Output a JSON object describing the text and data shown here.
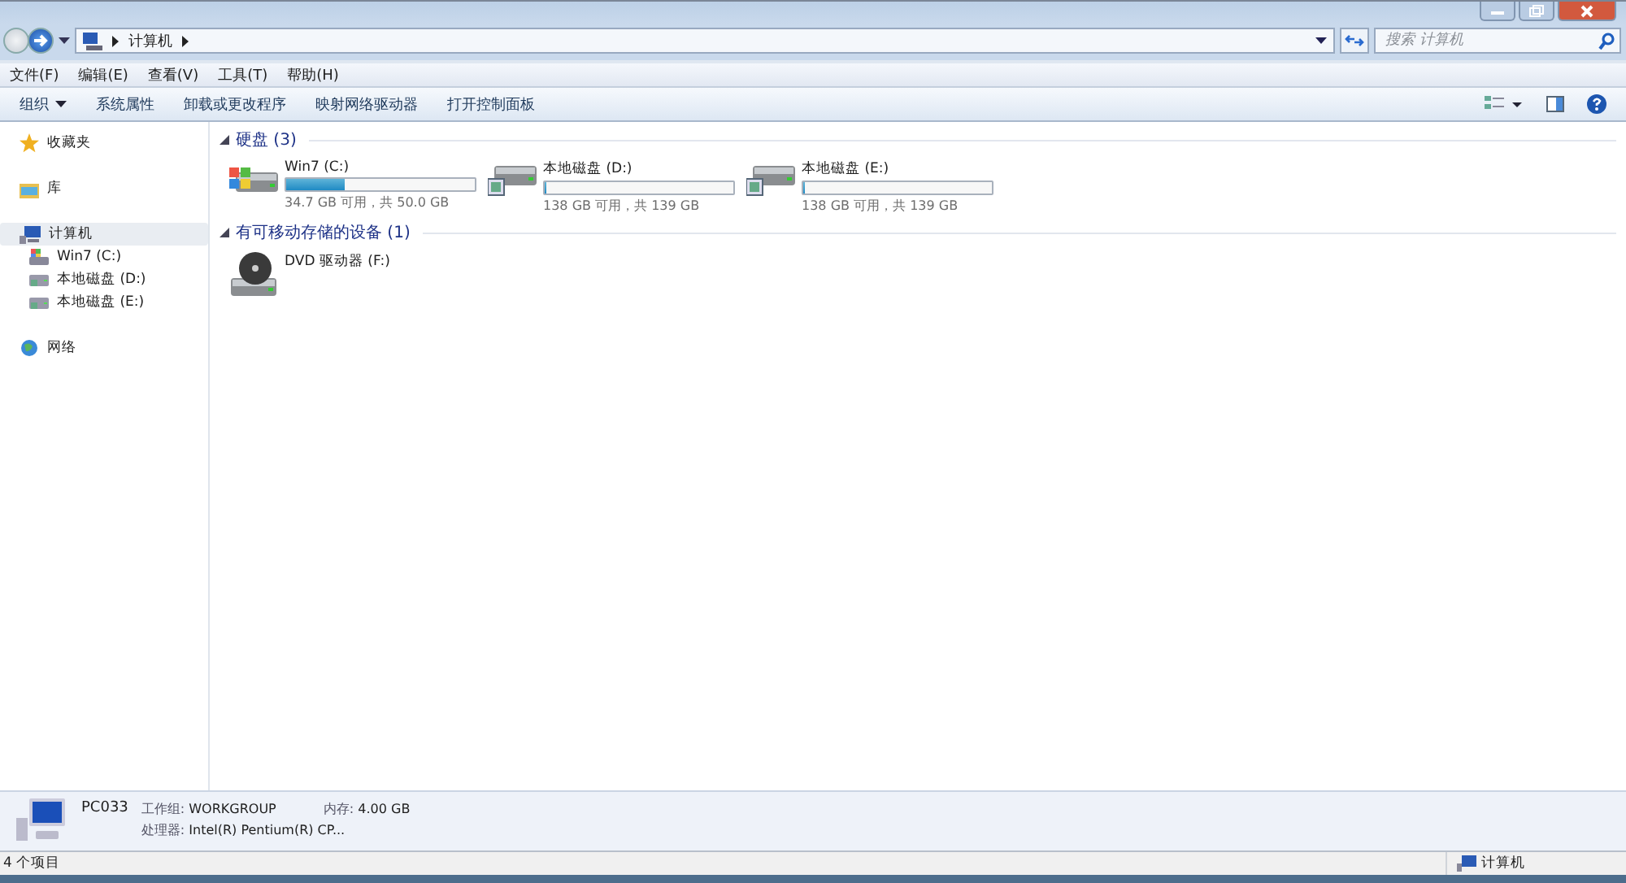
{
  "address": {
    "crumbs": [
      "计算机"
    ]
  },
  "search": {
    "placeholder": "搜索 计算机"
  },
  "menu": [
    "文件(F)",
    "编辑(E)",
    "查看(V)",
    "工具(T)",
    "帮助(H)"
  ],
  "toolbar": [
    {
      "label": "组织",
      "kind": "dropdown"
    },
    {
      "label": "系统属性",
      "kind": "plain"
    },
    {
      "label": "卸载或更改程序",
      "kind": "plain"
    },
    {
      "label": "映射网络驱动器",
      "kind": "plain"
    },
    {
      "label": "打开控制面板",
      "kind": "plain"
    }
  ],
  "sidebar": {
    "items": [
      {
        "label": "收藏夹",
        "kind": "star",
        "selected": false
      },
      {
        "label": "库",
        "kind": "library",
        "selected": false
      },
      {
        "label": "计算机",
        "kind": "computer",
        "selected": true,
        "children": [
          {
            "label": "Win7 (C:)",
            "kind": "windisk",
            "selected": false
          },
          {
            "label": "本地磁盘 (D:)",
            "kind": "disk",
            "selected": false
          },
          {
            "label": "本地磁盘 (E:)",
            "kind": "disk",
            "selected": false
          }
        ]
      },
      {
        "label": "网络",
        "kind": "network",
        "selected": false
      }
    ]
  },
  "groups": [
    {
      "title": "硬盘 (3)",
      "expanded": true,
      "items": [
        {
          "name": "Win7 (C:)",
          "kind": "windisk",
          "level": 0.31,
          "info": "34.7 GB 可用，共 50.0 GB"
        },
        {
          "name": "本地磁盘 (D:)",
          "kind": "disk",
          "level": 0.01,
          "info": "138 GB 可用，共 139 GB"
        },
        {
          "name": "本地磁盘 (E:)",
          "kind": "disk",
          "level": 0.01,
          "info": "138 GB 可用，共 139 GB"
        }
      ]
    },
    {
      "title": "有可移动存储的设备 (1)",
      "expanded": true,
      "items": [
        {
          "name": "DVD 驱动器 (F:)",
          "kind": "dvd"
        }
      ]
    }
  ],
  "details": {
    "name": "PC033",
    "fields": [
      {
        "label": "工作组:",
        "value": "WORKGROUP"
      },
      {
        "label": "内存:",
        "value": "4.00 GB"
      },
      {
        "label": "处理器:",
        "value": "Intel(R) Pentium(R) CP..."
      }
    ]
  },
  "status_bar": {
    "count": "4 个项目",
    "location": "计算机"
  }
}
